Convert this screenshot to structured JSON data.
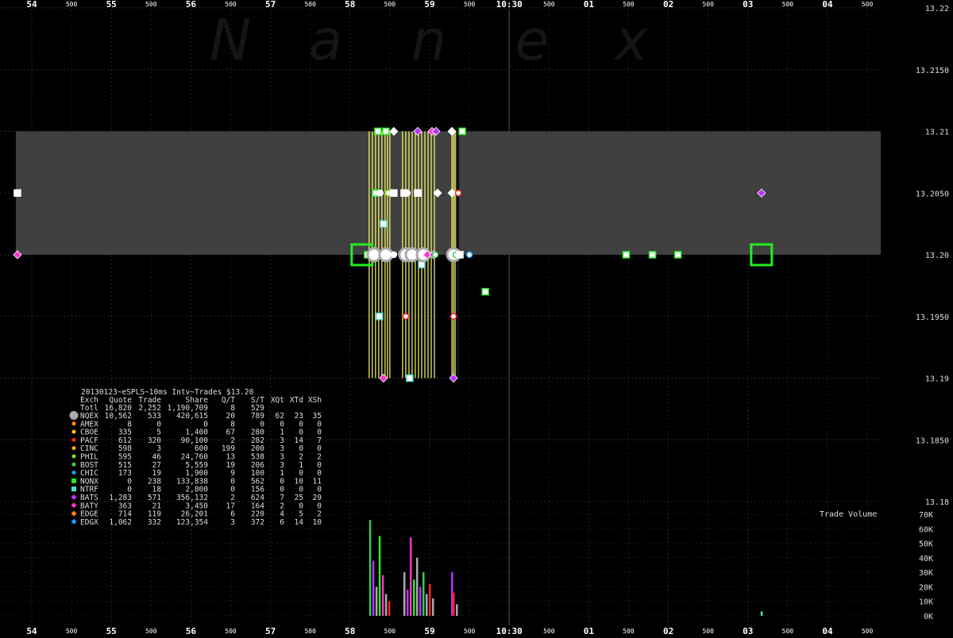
{
  "watermark": [
    "N",
    "a",
    "n",
    "e",
    "x"
  ],
  "time_axis": {
    "major_labels": [
      "54",
      "55",
      "56",
      "57",
      "58",
      "59",
      "10:30",
      "01",
      "02",
      "03",
      "04"
    ],
    "minor_label": "500"
  },
  "legend": {
    "title": "20130123~eSPLS~10ms Intv~Trades $13.20",
    "columns": [
      "Exch",
      "Quote",
      "Trade",
      "Share",
      "Q/T",
      "S/T",
      "XQt",
      "XTd",
      "XSh"
    ],
    "total_row": [
      "Totl",
      "16,820",
      "2,252",
      "1,190,709",
      "8",
      "529",
      "",
      "",
      ""
    ],
    "rows": [
      {
        "marker": "circle-lg",
        "color": "#aaaaaa",
        "cells": [
          "NQEX",
          "10,562",
          "533",
          "420,615",
          "20",
          "789",
          "62",
          "23",
          "35"
        ]
      },
      {
        "marker": "circle",
        "color": "#ff8800",
        "cells": [
          "AMEX",
          "8",
          "0",
          "0",
          "8",
          "0",
          "0",
          "0",
          "0"
        ]
      },
      {
        "marker": "circle",
        "color": "#ffcc00",
        "cells": [
          "CBOE",
          "335",
          "5",
          "1,400",
          "67",
          "280",
          "1",
          "0",
          "0"
        ]
      },
      {
        "marker": "circle",
        "color": "#ff2222",
        "cells": [
          "PACF",
          "612",
          "320",
          "90,100",
          "2",
          "282",
          "3",
          "14",
          "7"
        ]
      },
      {
        "marker": "circle",
        "color": "#ffaa00",
        "cells": [
          "CINC",
          "598",
          "3",
          "600",
          "199",
          "200",
          "3",
          "0",
          "0"
        ]
      },
      {
        "marker": "circle",
        "color": "#88dd22",
        "cells": [
          "PHIL",
          "595",
          "46",
          "24,760",
          "13",
          "538",
          "3",
          "2",
          "2"
        ]
      },
      {
        "marker": "circle",
        "color": "#33cc55",
        "cells": [
          "BOST",
          "515",
          "27",
          "5,559",
          "19",
          "206",
          "3",
          "1",
          "0"
        ]
      },
      {
        "marker": "circle",
        "color": "#2299ff",
        "cells": [
          "CHIC",
          "173",
          "19",
          "1,900",
          "9",
          "100",
          "1",
          "0",
          "0"
        ]
      },
      {
        "marker": "square",
        "color": "#22ee22",
        "cells": [
          "NQNX",
          "0",
          "238",
          "133,838",
          "0",
          "562",
          "0",
          "10",
          "11"
        ]
      },
      {
        "marker": "square",
        "color": "#55ddcc",
        "cells": [
          "NTRF",
          "0",
          "18",
          "2,800",
          "0",
          "156",
          "0",
          "0",
          "0"
        ]
      },
      {
        "marker": "diamond",
        "color": "#bb33ff",
        "cells": [
          "BATS",
          "1,283",
          "571",
          "356,132",
          "2",
          "624",
          "7",
          "25",
          "29"
        ]
      },
      {
        "marker": "diamond",
        "color": "#ff33cc",
        "cells": [
          "BATY",
          "363",
          "21",
          "3,450",
          "17",
          "164",
          "2",
          "0",
          "0"
        ]
      },
      {
        "marker": "diamond",
        "color": "#ff8800",
        "cells": [
          "EDGE",
          "714",
          "119",
          "26,201",
          "6",
          "220",
          "4",
          "5",
          "2"
        ]
      },
      {
        "marker": "diamond",
        "color": "#2299ff",
        "cells": [
          "EDGX",
          "1,062",
          "332",
          "123,354",
          "3",
          "372",
          "6",
          "14",
          "10"
        ]
      }
    ]
  },
  "chart_data": {
    "type": "scatter",
    "title": "20130123~eSPLS~10ms Intv~Trades $13.20",
    "xlabel": "",
    "ylabel": "",
    "x_tick_labels": [
      "54",
      "55",
      "56",
      "57",
      "58",
      "59",
      "10:30",
      "01",
      "02",
      "03",
      "04"
    ],
    "price_axis": {
      "ticks": [
        13.22,
        13.215,
        13.21,
        13.205,
        13.2,
        13.195,
        13.19,
        13.185,
        13.18
      ],
      "tick_labels": [
        "13.22",
        "13.2150",
        "13.21",
        "13.2050",
        "13.20",
        "13.1950",
        "13.19",
        "13.1850",
        "13.18"
      ],
      "ylim": [
        13.18,
        13.22
      ]
    },
    "nbbo_band": {
      "bid": 13.2,
      "ask": 13.21,
      "color": "#404040"
    },
    "volume_axis": {
      "title": "Trade Volume",
      "ticks": [
        0,
        10000,
        20000,
        30000,
        40000,
        50000,
        60000,
        70000
      ],
      "tick_labels": [
        "0K",
        "10K",
        "20K",
        "30K",
        "40K",
        "50K",
        "60K",
        "70K"
      ],
      "ylim": [
        0,
        70000
      ]
    },
    "quotes_and_trades": [
      {
        "t": 53.82,
        "price": 13.205,
        "marker": "square",
        "color": "#ffffff"
      },
      {
        "t": 53.82,
        "price": 13.2,
        "marker": "diamond",
        "color": "#ff33cc"
      },
      {
        "t": 58.15,
        "price": 13.2,
        "marker": "square-lg",
        "color": "#22ee22"
      },
      {
        "t": 58.22,
        "price": 13.2,
        "marker": "square",
        "color": "#22ee22"
      },
      {
        "t": 58.3,
        "price": 13.2,
        "marker": "circle-lg",
        "color": "#aaaaaa"
      },
      {
        "t": 58.35,
        "price": 13.21,
        "marker": "square",
        "color": "#22ee22"
      },
      {
        "t": 58.45,
        "price": 13.21,
        "marker": "square",
        "color": "#22ee22"
      },
      {
        "t": 58.32,
        "price": 13.205,
        "marker": "square",
        "color": "#22ee22"
      },
      {
        "t": 58.38,
        "price": 13.205,
        "marker": "circle",
        "color": "#ffffff"
      },
      {
        "t": 58.48,
        "price": 13.205,
        "marker": "circle",
        "color": "#88dd22"
      },
      {
        "t": 58.45,
        "price": 13.2,
        "marker": "circle-lg",
        "color": "#aaaaaa"
      },
      {
        "t": 58.55,
        "price": 13.2,
        "marker": "circle",
        "color": "#ffffff"
      },
      {
        "t": 58.42,
        "price": 13.2025,
        "marker": "square",
        "color": "#55ddcc"
      },
      {
        "t": 58.37,
        "price": 13.195,
        "marker": "square",
        "color": "#55ddcc"
      },
      {
        "t": 58.42,
        "price": 13.19,
        "marker": "diamond",
        "color": "#ff33cc"
      },
      {
        "t": 58.55,
        "price": 13.21,
        "marker": "diamond",
        "color": "#ffffff"
      },
      {
        "t": 58.55,
        "price": 13.205,
        "marker": "square",
        "color": "#ffffff"
      },
      {
        "t": 58.68,
        "price": 13.205,
        "marker": "square",
        "color": "#ffffff"
      },
      {
        "t": 58.72,
        "price": 13.205,
        "marker": "circle",
        "color": "#ffffff"
      },
      {
        "t": 58.7,
        "price": 13.2,
        "marker": "circle-lg",
        "color": "#aaaaaa"
      },
      {
        "t": 58.78,
        "price": 13.2,
        "marker": "circle-lg",
        "color": "#aaaaaa"
      },
      {
        "t": 58.7,
        "price": 13.195,
        "marker": "circle",
        "color": "#ff2222"
      },
      {
        "t": 58.75,
        "price": 13.19,
        "marker": "square",
        "color": "#55ddcc"
      },
      {
        "t": 58.85,
        "price": 13.21,
        "marker": "diamond",
        "color": "#bb33ff"
      },
      {
        "t": 58.85,
        "price": 13.205,
        "marker": "square",
        "color": "#ffffff"
      },
      {
        "t": 58.9,
        "price": 13.1992,
        "marker": "square",
        "color": "#55ddcc"
      },
      {
        "t": 58.92,
        "price": 13.2,
        "marker": "circle-lg",
        "color": "#aaaaaa"
      },
      {
        "t": 58.97,
        "price": 13.2,
        "marker": "diamond",
        "color": "#ff33cc"
      },
      {
        "t": 59.05,
        "price": 13.2,
        "marker": "diamond",
        "color": "#bb33ff"
      },
      {
        "t": 59.03,
        "price": 13.21,
        "marker": "diamond",
        "color": "#ff33cc"
      },
      {
        "t": 59.08,
        "price": 13.21,
        "marker": "diamond",
        "color": "#bb33ff"
      },
      {
        "t": 59.07,
        "price": 13.2,
        "marker": "circle",
        "color": "#33cc55"
      },
      {
        "t": 59.1,
        "price": 13.205,
        "marker": "diamond",
        "color": "#ffffff"
      },
      {
        "t": 59.28,
        "price": 13.21,
        "marker": "diamond",
        "color": "#ffffff"
      },
      {
        "t": 59.28,
        "price": 13.205,
        "marker": "diamond",
        "color": "#ffffff"
      },
      {
        "t": 59.3,
        "price": 13.2,
        "marker": "circle-lg",
        "color": "#aaaaaa"
      },
      {
        "t": 59.33,
        "price": 13.2,
        "marker": "circle",
        "color": "#33cc55"
      },
      {
        "t": 59.36,
        "price": 13.205,
        "marker": "circle",
        "color": "#ff2222"
      },
      {
        "t": 59.3,
        "price": 13.195,
        "marker": "circle",
        "color": "#ff2222"
      },
      {
        "t": 59.3,
        "price": 13.19,
        "marker": "diamond",
        "color": "#bb33ff"
      },
      {
        "t": 59.41,
        "price": 13.21,
        "marker": "square",
        "color": "#22ee22"
      },
      {
        "t": 59.38,
        "price": 13.2,
        "marker": "square",
        "color": "#ffffff"
      },
      {
        "t": 59.5,
        "price": 13.2,
        "marker": "circle",
        "color": "#2299ff"
      },
      {
        "t": 59.7,
        "price": 13.197,
        "marker": "square",
        "color": "#22ee22"
      },
      {
        "t": 61.47,
        "price": 13.2,
        "marker": "square",
        "color": "#22ee22"
      },
      {
        "t": 61.8,
        "price": 13.2,
        "marker": "square",
        "color": "#22ee22"
      },
      {
        "t": 62.12,
        "price": 13.2,
        "marker": "square",
        "color": "#22ee22"
      },
      {
        "t": 63.17,
        "price": 13.205,
        "marker": "diamond",
        "color": "#bb33ff"
      },
      {
        "t": 63.17,
        "price": 13.2,
        "marker": "square-lg",
        "color": "#22ee22"
      }
    ],
    "trade_highlights": [
      {
        "t": 58.24,
        "color": "#ffff66"
      },
      {
        "t": 58.28,
        "color": "#ffff66"
      },
      {
        "t": 58.32,
        "color": "#ffff66"
      },
      {
        "t": 58.36,
        "color": "#ffff66"
      },
      {
        "t": 58.4,
        "color": "#ffff66"
      },
      {
        "t": 58.44,
        "color": "#ffff66"
      },
      {
        "t": 58.47,
        "color": "#ffff66"
      },
      {
        "t": 58.5,
        "color": "#ffff66"
      },
      {
        "t": 58.66,
        "color": "#ffff66"
      },
      {
        "t": 58.7,
        "color": "#ffff66"
      },
      {
        "t": 58.74,
        "color": "#ffff66"
      },
      {
        "t": 58.78,
        "color": "#ffff66"
      },
      {
        "t": 58.82,
        "color": "#ffff66"
      },
      {
        "t": 58.86,
        "color": "#ffff66"
      },
      {
        "t": 58.9,
        "color": "#ffff66"
      },
      {
        "t": 58.94,
        "color": "#ffff66"
      },
      {
        "t": 58.98,
        "color": "#ffff66"
      },
      {
        "t": 59.02,
        "color": "#ffff66"
      },
      {
        "t": 59.06,
        "color": "#ffff66"
      },
      {
        "t": 59.28,
        "color": "#ffff66"
      },
      {
        "t": 59.3,
        "color": "#ffff66"
      },
      {
        "t": 59.32,
        "color": "#ffff66"
      }
    ],
    "volume_bars": [
      {
        "t": 58.25,
        "v": 66000,
        "color": "#33cc55"
      },
      {
        "t": 58.29,
        "v": 38000,
        "color": "#bb33ff"
      },
      {
        "t": 58.33,
        "v": 20000,
        "color": "#aaaaaa"
      },
      {
        "t": 58.37,
        "v": 55000,
        "color": "#22ee22"
      },
      {
        "t": 58.41,
        "v": 28000,
        "color": "#ff33cc"
      },
      {
        "t": 58.45,
        "v": 15000,
        "color": "#aaaaaa"
      },
      {
        "t": 58.49,
        "v": 10000,
        "color": "#ff2222"
      },
      {
        "t": 58.68,
        "v": 30000,
        "color": "#aaaaaa"
      },
      {
        "t": 58.72,
        "v": 18000,
        "color": "#bb33ff"
      },
      {
        "t": 58.76,
        "v": 54000,
        "color": "#ff33cc"
      },
      {
        "t": 58.8,
        "v": 25000,
        "color": "#22ee22"
      },
      {
        "t": 58.84,
        "v": 40000,
        "color": "#aaaaaa"
      },
      {
        "t": 58.88,
        "v": 20000,
        "color": "#bb33ff"
      },
      {
        "t": 58.92,
        "v": 30000,
        "color": "#33cc55"
      },
      {
        "t": 58.96,
        "v": 15000,
        "color": "#aaaaaa"
      },
      {
        "t": 59.0,
        "v": 22000,
        "color": "#ff2222"
      },
      {
        "t": 59.04,
        "v": 12000,
        "color": "#aaaaaa"
      },
      {
        "t": 59.28,
        "v": 30000,
        "color": "#bb33ff"
      },
      {
        "t": 59.3,
        "v": 16000,
        "color": "#ff2222"
      },
      {
        "t": 59.34,
        "v": 8000,
        "color": "#aaaaaa"
      },
      {
        "t": 63.17,
        "v": 3000,
        "color": "#55ddcc"
      }
    ]
  }
}
